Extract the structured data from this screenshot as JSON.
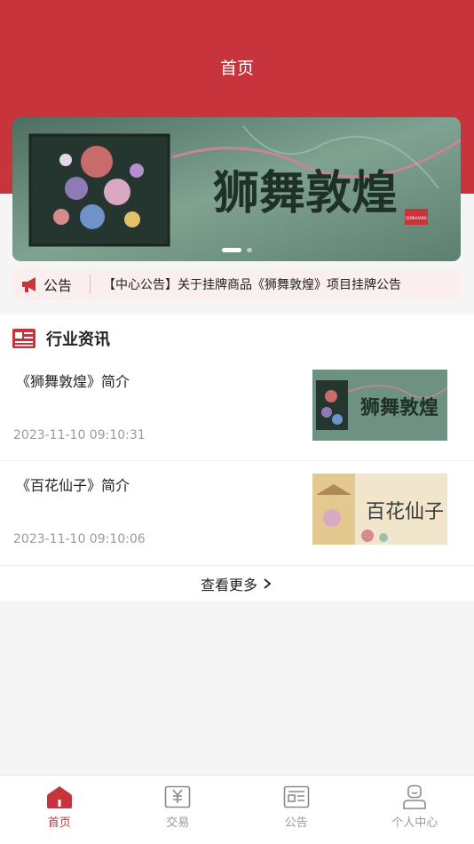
{
  "header": {
    "title": "首页",
    "brand_color": "#c8343c"
  },
  "banner": {
    "caption": "狮舞敦煌",
    "stamp": "DUNHUANG",
    "slide_count": 2,
    "active_slide": 1
  },
  "notice": {
    "label": "公告",
    "text": "【中心公告】关于挂牌商品《狮舞敦煌》项目挂牌公告",
    "icon": "megaphone-icon"
  },
  "news": {
    "section_title": "行业资讯",
    "section_icon": "news-icon",
    "items": [
      {
        "title": "《狮舞敦煌》简介",
        "date": "2023-11-10 09:10:31",
        "thumb_caption": "狮舞敦煌"
      },
      {
        "title": "《百花仙子》简介",
        "date": "2023-11-10 09:10:06",
        "thumb_caption": "百花仙子"
      }
    ],
    "more_label": "查看更多"
  },
  "tabbar": {
    "items": [
      {
        "label": "首页",
        "icon": "home-icon",
        "active": true
      },
      {
        "label": "交易",
        "icon": "trade-icon",
        "active": false
      },
      {
        "label": "公告",
        "icon": "announcement-icon",
        "active": false
      },
      {
        "label": "个人中心",
        "icon": "profile-icon",
        "active": false
      }
    ]
  }
}
